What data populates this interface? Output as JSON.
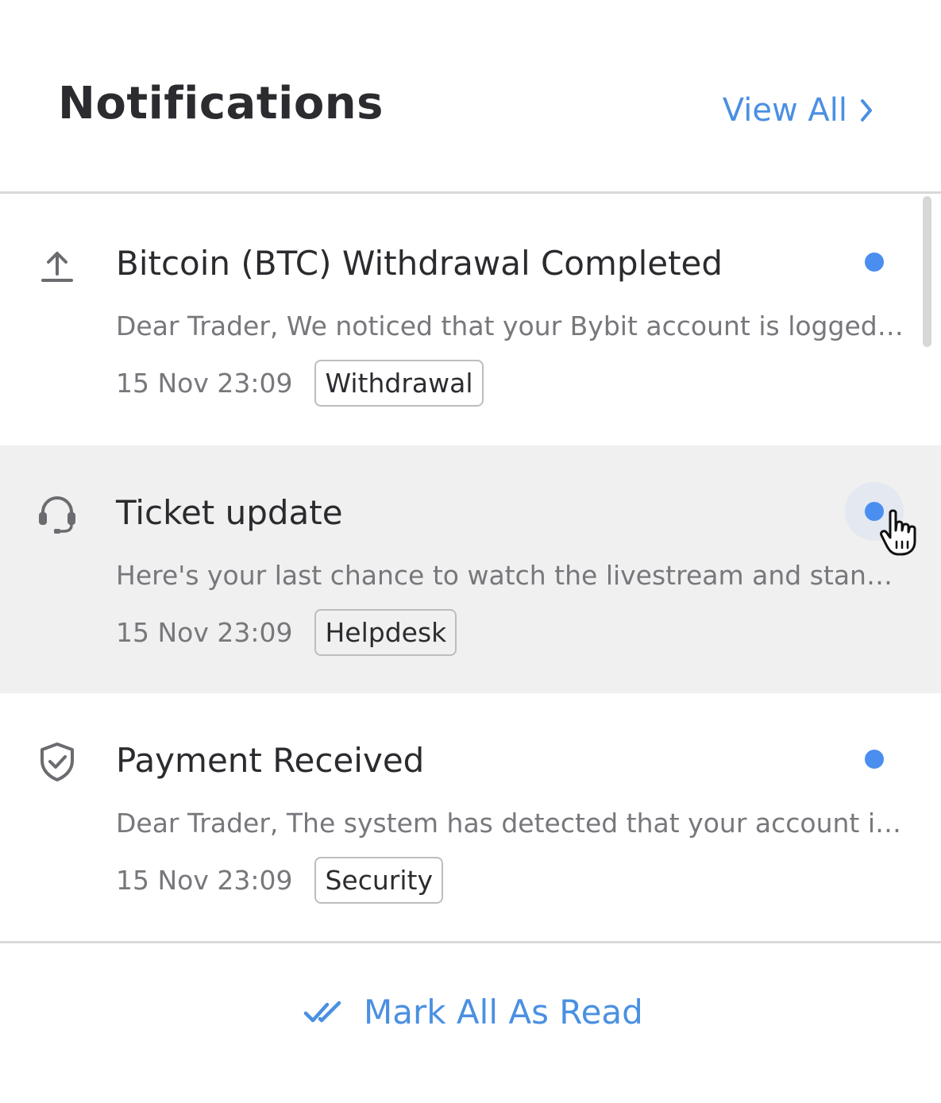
{
  "header": {
    "title": "Notifications",
    "view_all_label": "View All"
  },
  "notifications": [
    {
      "icon": "upload-icon",
      "title": "Bitcoin (BTC) Withdrawal Completed",
      "body": "Dear Trader,   We noticed that your Bybit account is logged in from a new device",
      "time": "15 Nov 23:09",
      "tag": "Withdrawal",
      "unread": true
    },
    {
      "icon": "headset-icon",
      "title": "Ticket update",
      "body": "Here's your last chance to watch the livestream and stand a chance to win prizes",
      "time": "15 Nov 23:09",
      "tag": "Helpdesk",
      "unread": true
    },
    {
      "icon": "shield-check-icon",
      "title": "Payment Received",
      "body": "Dear Trader, The system has detected that your account is logged in from a new location",
      "time": "15 Nov 23:09",
      "tag": "Security",
      "unread": true
    }
  ],
  "footer": {
    "mark_all_label": "Mark All As Read"
  },
  "colors": {
    "accent": "#4a90e2",
    "unread_dot": "#4a8ef0",
    "hover_row": "#f0f0f0"
  }
}
